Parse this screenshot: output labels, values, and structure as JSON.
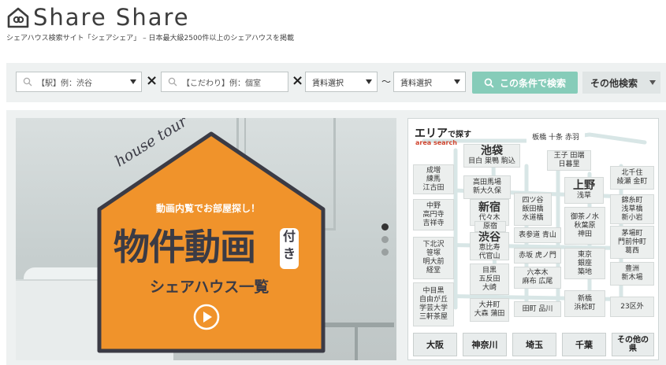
{
  "header": {
    "logo_text": "Share Share",
    "tagline": "シェアハウス検索サイト「シェアシェア」 – 日本最大級2500件以上のシェアハウスを掲載"
  },
  "search": {
    "station_placeholder": "【駅】例：渋谷",
    "feature_placeholder": "【こだわり】例：個室",
    "rent_min_label": "賃料選択",
    "rent_max_label": "賃料選択",
    "times_symbol": "×",
    "range_symbol": "〜",
    "search_button": "この条件で検索",
    "other_search": "その他検索"
  },
  "banner": {
    "script_text": "house tour",
    "subtitle": "動画内覧でお部屋探し！",
    "main_title": "物件動画",
    "title_suffix": "付き",
    "caption": "シェアハウス一覧",
    "accent_color": "#f0932b"
  },
  "area": {
    "title": "エリア",
    "title_suffix": "で探す",
    "subtitle": "area search",
    "top_label": "板橋 十条 赤羽",
    "tiles": [
      {
        "big": "池袋",
        "small": "目白 巣鴨 駒込"
      },
      {
        "big": "",
        "small": "王子 田端\n日暮里"
      },
      {
        "big": "",
        "small": "成増\n練馬\n江古田"
      },
      {
        "big": "",
        "small": "高田馬場\n新大久保"
      },
      {
        "big": "新宿",
        "small": "代々木"
      },
      {
        "big": "",
        "small": "四ツ谷\n飯田橋\n水道橋"
      },
      {
        "big": "上野",
        "small": "浅草"
      },
      {
        "big": "",
        "small": "北千住\n綾瀬 金町"
      },
      {
        "big": "",
        "small": "中野\n高円寺\n吉祥寺"
      },
      {
        "big": "",
        "small": "原宿"
      },
      {
        "big": "渋谷",
        "small": "恵比寿\n代官山"
      },
      {
        "big": "",
        "small": "御茶ノ水\n秋葉原\n神田"
      },
      {
        "big": "",
        "small": "錦糸町\n浅草橋\n新小岩"
      },
      {
        "big": "",
        "small": "下北沢\n笹塚\n明大前\n経堂"
      },
      {
        "big": "",
        "small": "表参道 青山"
      },
      {
        "big": "",
        "small": "茅場町\n門前仲町\n葛西"
      },
      {
        "big": "",
        "small": "赤坂 虎ノ門"
      },
      {
        "big": "",
        "small": "東京\n銀座\n築地"
      },
      {
        "big": "",
        "small": "目黒\n五反田\n大崎"
      },
      {
        "big": "",
        "small": "六本木\n麻布 広尾"
      },
      {
        "big": "",
        "small": "豊洲\n新木場"
      },
      {
        "big": "",
        "small": "中目黒\n自由が丘\n学芸大学\n三軒茶屋"
      },
      {
        "big": "",
        "small": "大井町\n大森 蒲田"
      },
      {
        "big": "",
        "small": "田町 品川"
      },
      {
        "big": "",
        "small": "新橋\n浜松町"
      },
      {
        "big": "",
        "small": "23区外"
      }
    ],
    "prefectures": [
      "大阪",
      "神奈川",
      "埼玉",
      "千葉",
      "その他の県"
    ]
  },
  "colors": {
    "search_button": "#86ccb9",
    "banner_orange": "#f0932b",
    "area_accent": "#d0452f"
  }
}
